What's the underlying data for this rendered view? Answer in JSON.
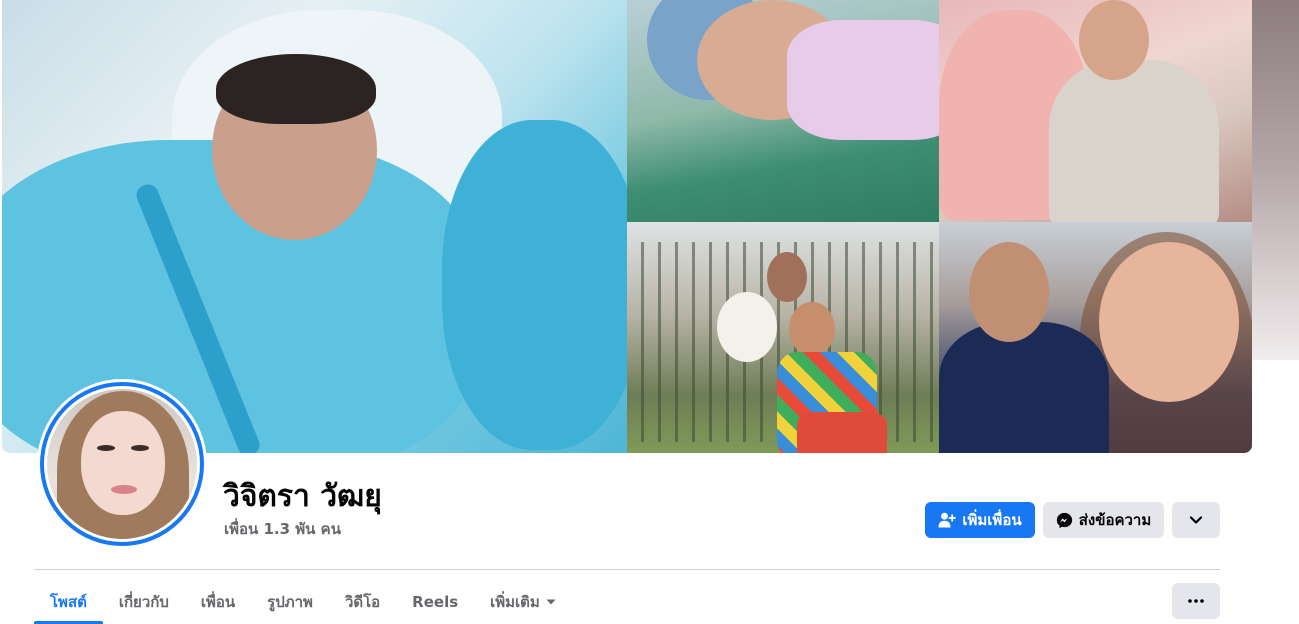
{
  "profile": {
    "name": "วิจิตรา วัฒยุ",
    "friends_count": "เพื่อน 1.3 พัน คน"
  },
  "actions": {
    "add_friend_label": "เพิ่มเพื่อน",
    "message_label": "ส่งข้อความ",
    "more_icon": "chevron-down-icon"
  },
  "tabs": [
    {
      "label": "โพสต์",
      "active": true
    },
    {
      "label": "เกี่ยวกับ",
      "active": false
    },
    {
      "label": "เพื่อน",
      "active": false
    },
    {
      "label": "รูปภาพ",
      "active": false
    },
    {
      "label": "วิดีโอ",
      "active": false
    },
    {
      "label": "Reels",
      "active": false
    },
    {
      "label": "เพิ่มเติม",
      "active": false
    }
  ],
  "tabs_more_icon": "ellipsis-icon",
  "colors": {
    "accent": "#1877f2",
    "secondary_button": "#e4e6eb",
    "muted_text": "#65676b",
    "primary_text": "#050505"
  }
}
